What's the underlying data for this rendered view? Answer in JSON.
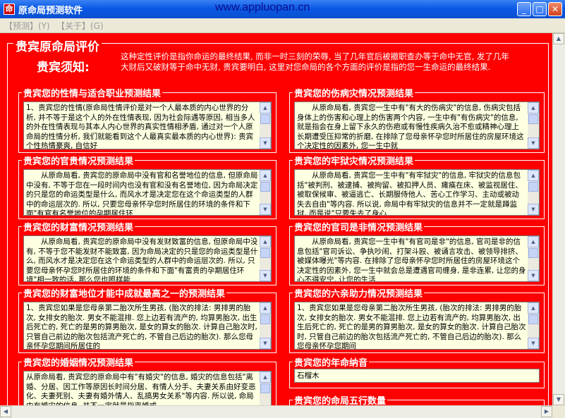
{
  "window": {
    "title": "原命局预测软件",
    "url_banner": "www.appluopan.cn",
    "buttons": {
      "minimize": "_",
      "maximize": "□",
      "close": "✕"
    }
  },
  "menu": [
    {
      "label": "【预测】(Y)"
    },
    {
      "label": "【关于】(G)"
    }
  ],
  "main": {
    "frame_title": "贵宾原命局评价",
    "notice_label": "贵宾须知:",
    "notice_text": "这种定性评价是指你命运的最终结果, 而非一时三刻的荣辱, 当了几年官后被撤职查办等于命中无官, 发了几年大财后又破财等于命中无财, 贵宾要明白, 这里对您命局的各个方面的评价是指的您一生命运的最终结果."
  },
  "panels": [
    {
      "title": "贵宾您的性情与适合职业预测结果",
      "text": "1、贵宾您的性情(原命局性情评价是对一个人最本质的内心世界的分析, 并不等于是这个人的外在性情表现, 因为社会际遇等原因, 相当多人的外在性情表现与其本人内心世界的真实性情相矛盾, 通过对一个人原命局的性情分析, 我们就能看到这个人最真实最本质的内心世界): 贵宾个性热情豪爽, 自信好"
    },
    {
      "title": "贵宾您的伤病灾情况预测结果",
      "text": "　　从原命局看, 贵宾您一生中有\"有大的伤病灾\"的信息, 伤病灾包括身体上的伤害和心理上的伤害两个内容, 一生中有\"有伤病灾\"的信息, 就是指会在身上留下永久的伤疤或有慢性疾病久治不愈或精神心理上长期遭受压抑常的折磨, 在排除了您母亲怀孕您时所居住的房屋环境这个决定性的因素外, 您一生中就"
    },
    {
      "title": "贵宾您的官贵情况预测结果",
      "text": "　　从原命局看, 贵宾您的原命局中没有官和名誉地位的信息, 但原命局中没有, 不等于您在一段时间内也没有官和没有名誉地位, 因为命局决定的只是您的命运类型是什么, 而风水才是决定您在这个命运类型的人群中的命运层次的. 所以, 只要您母亲怀孕您时所居住的环境的条件和下面\"有官有名誉地位的孕期居住环"
    },
    {
      "title": "贵宾您的牢狱灾情况预测结果",
      "text": "　　从原命局看, 贵宾您一生中有\"有牢狱灾\"的信息, 牢狱灾的信息包括\"被判刑、被逮捕、被拘留、被扣押人员、瘫痪在床、被监视居住、被取保候审、被逼逃亡、长期服侍他人、苦心工作学习、主动或被动失去自由\"等内容. 所以说, 命局中有牢狱灾的信息并不一定就是蹲监狱, 而是说\"只要失去了身心"
    },
    {
      "title": "贵宾您的财富情况预测结果",
      "text": "　　从原命局看, 贵宾您的原命局中没有发财致富的信息, 但原命局中没有, 不等于您不能发财不能致富, 因为命局决定的只是您的命运类型是什么, 而风水才是决定您在这个命运类型的人群中的命运层次的. 所以, 只要您母亲怀孕您时所居住的环境的条件和下面\"有富贵的孕期居住环境\"相一致的话, 那么您也照样能"
    },
    {
      "title": "贵宾您的官司是非情况预测结果",
      "text": "　　从原命局看, 贵宾您一生中有\"有官司是非\"的信息, 官司是非的信息包括\"官司诉讼、争执吵闹、打架斗殴、被诵言攻击、被领导排挤、被媒体曝光\"等内容. 在排除了您母亲怀孕您时所居住的房屋环境这个决定性的因素外, 您一生中就会总是遭遇官司缠身, 是非连累, 让您的身心不得安宁, 让您的生活"
    },
    {
      "title": "贵宾您的财富地位才能中成就最高之一的预测结果",
      "text": "1、贵宾您如果是您母亲第二胎次所生男孩, (胎次的排法: 男排男的胎次, 女排女的胎次. 男女不能混排. 您上边若有流产的, 均算男胎次, 出生后死亡的, 死亡的是男的算男胎次, 是女的算女的胎次. 计算自己胎次时, 只管自己前边的胎次包括流产死亡的, 不管自己后边的胎次). 那么您母亲怀孕您期间所居住的"
    },
    {
      "title": "贵宾您的六亲助力情况预测结果",
      "text": "1、贵宾您如果是您母亲第二胎次所生男孩, (胎次的排法: 男排男的胎次, 女排女的胎次. 男女不能混排. 您上边若有流产的, 均算男胎次, 出生后死亡的, 死亡的是男的算男胎次, 是女的算女的胎次. 计算自己胎次时, 只管自己前边的胎次包括流产死亡的, 不管自己后边的胎次). 那么您母亲怀孕您期间"
    },
    {
      "title": "贵宾您的婚姻情况预测结果",
      "text": "从原命局看, 贵宾您的原命局中有\"有婚灾\"的信息, 婚灾的信息包括\"离婚、分居、因工作等原因长时间分居、有情人分手、夫妻关系由好变恶化、夫妻死别、夫妻有婚外情人、乱搞男女关系\"等内容. 所以说, 命局中有婚灾的信息, 并不一定就是指离婚或"
    },
    {
      "title": "贵宾您的年命纳音",
      "text": "石榴木"
    },
    {
      "title": "贵宾您的命局五行数量",
      "text": ""
    }
  ]
}
